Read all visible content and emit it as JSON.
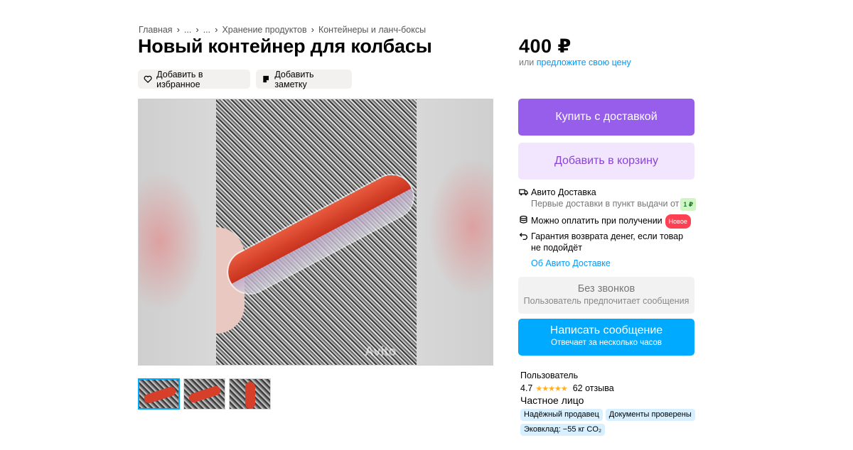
{
  "breadcrumb": {
    "items": [
      "Главная",
      "...",
      "...",
      "Хранение продуктов",
      "Контейнеры и ланч-боксы"
    ],
    "separator": "›"
  },
  "title": "Новый контейнер для колбасы",
  "actions": {
    "favorite_label": "Добавить в избранное",
    "note_label": "Добавить заметку"
  },
  "gallery": {
    "watermark": "Avito",
    "thumbnail_count": 3
  },
  "price": {
    "amount": "400 ₽",
    "or_text": "или",
    "offer_link": "предложите свою цену"
  },
  "buttons": {
    "buy_delivery": "Купить с доставкой",
    "add_to_cart": "Добавить в корзину"
  },
  "delivery": {
    "title": "Авито Доставка",
    "subtitle": "Первые доставки в пункт выдачи от",
    "badge": "1 ₽",
    "pay_on_receipt": "Можно оплатить при получении",
    "new_badge": "Новое",
    "guarantee_line1": "Гарантия возврата денег, если товар",
    "guarantee_line2": "не подойдёт",
    "link": "Об Авито Доставке"
  },
  "no_calls": {
    "title": "Без звонков",
    "subtitle": "Пользователь предпочитает сообщения"
  },
  "message": {
    "title": "Написать сообщение",
    "subtitle": "Отвечает за несколько часов"
  },
  "seller": {
    "name": "Пользователь",
    "rating": "4.7",
    "stars": "★★★★★",
    "reviews": "62 отзыва",
    "type": "Частное лицо",
    "tags": [
      "Надёжный продавец",
      "Документы проверены",
      "Эковклад: −55 кг CO₂"
    ]
  },
  "colors": {
    "buy": "#965eeb",
    "cart_bg": "#f1e6fd",
    "message": "#00aaff",
    "link": "#0099f7"
  }
}
